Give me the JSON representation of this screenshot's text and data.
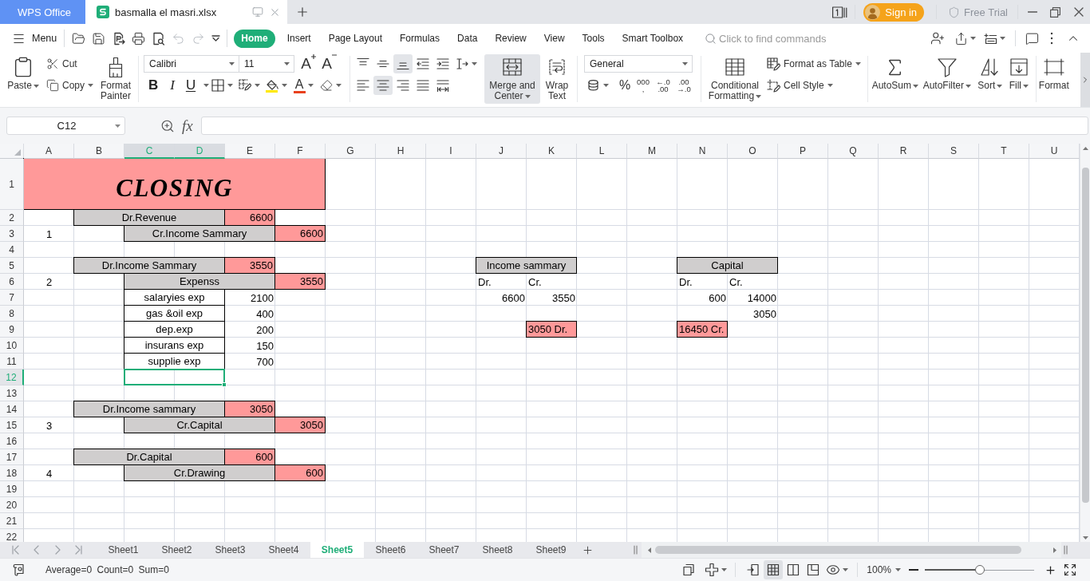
{
  "title_bar": {
    "app_tab": "WPS Office",
    "document_tab": "basmalla el masri.xlsx",
    "sign_in": "Sign in",
    "free_trial": "Free Trial"
  },
  "menu_bar": {
    "menu": "Menu",
    "quick_access": [
      {
        "kind": "open",
        "disabled": false
      },
      {
        "kind": "save",
        "disabled": false
      },
      {
        "kind": "export",
        "disabled": false
      },
      {
        "kind": "print",
        "disabled": false
      },
      {
        "kind": "preview",
        "disabled": false
      },
      {
        "kind": "undo",
        "disabled": true
      },
      {
        "kind": "redo",
        "disabled": true
      },
      {
        "kind": "customize",
        "disabled": false
      }
    ],
    "tabs": [
      {
        "label": "Home",
        "selected": true
      },
      {
        "label": "Insert",
        "selected": false
      },
      {
        "label": "Page Layout",
        "selected": false
      },
      {
        "label": "Formulas",
        "selected": false
      },
      {
        "label": "Data",
        "selected": false
      },
      {
        "label": "Review",
        "selected": false
      },
      {
        "label": "View",
        "selected": false
      },
      {
        "label": "Tools",
        "selected": false
      },
      {
        "label": "Smart Toolbox",
        "selected": false
      }
    ],
    "search": {
      "placeholder": "Click to find commands"
    }
  },
  "ribbon": {
    "paste": "Paste",
    "cut": "Cut",
    "copy": "Copy",
    "format_painter": [
      "Format",
      "Painter"
    ],
    "font_name": "Calibri",
    "font_size": "11",
    "size_buttons": [
      {
        "kind": "grow",
        "label": "A"
      },
      {
        "kind": "shrink",
        "label": "A"
      }
    ],
    "style_buttons": [
      {
        "kind": "bold",
        "label": "B"
      },
      {
        "kind": "italic",
        "label": "I"
      },
      {
        "kind": "underline",
        "label": "U"
      }
    ],
    "font_color": "A",
    "alignment_rows": [
      [
        {
          "kind": "top",
          "on": false
        },
        {
          "kind": "middle",
          "on": false
        },
        {
          "kind": "bottom",
          "on": true
        },
        {
          "kind": "outdent",
          "on": false
        },
        {
          "kind": "indent",
          "on": false
        },
        {
          "kind": "direction",
          "on": false
        }
      ],
      [
        {
          "kind": "left",
          "on": false
        },
        {
          "kind": "center",
          "on": true
        },
        {
          "kind": "right",
          "on": false
        },
        {
          "kind": "justify",
          "on": false
        },
        {
          "kind": "distributed",
          "on": false
        }
      ]
    ],
    "merge_center": {
      "lines": [
        "Merge and",
        "Center"
      ],
      "on": true
    },
    "wrap_text": [
      "Wrap",
      "Text"
    ],
    "number_format": "General",
    "number_buttons": [
      {
        "kind": "currency"
      },
      {
        "kind": "percent",
        "lines": [
          "%"
        ]
      },
      {
        "kind": "thousands",
        "lines": [
          "000",
          ","
        ]
      },
      {
        "kind": "increase_decimal",
        "lines": [
          "←.0",
          ".00"
        ]
      },
      {
        "kind": "decrease_decimal",
        "lines": [
          ".00",
          "→.0"
        ]
      }
    ],
    "conditional_formatting": [
      "Conditional",
      "Formatting"
    ],
    "format_as_table": "Format as Table",
    "cell_style": "Cell Style",
    "editing": [
      {
        "kind": "autosum",
        "label": "AutoSum"
      },
      {
        "kind": "autofilter",
        "label": "AutoFilter"
      },
      {
        "kind": "sort",
        "label": "Sort"
      },
      {
        "kind": "fill",
        "label": "Fill"
      },
      {
        "kind": "format",
        "label": "Format"
      }
    ]
  },
  "formula_bar": {
    "name_box": "C12",
    "function_label": "fx"
  },
  "sheet": {
    "columns": [
      {
        "label": "A",
        "selected": false
      },
      {
        "label": "B",
        "selected": false
      },
      {
        "label": "C",
        "selected": true
      },
      {
        "label": "D",
        "selected": true
      },
      {
        "label": "E",
        "selected": false
      },
      {
        "label": "F",
        "selected": false
      },
      {
        "label": "G",
        "selected": false
      },
      {
        "label": "H",
        "selected": false
      },
      {
        "label": "I",
        "selected": false
      },
      {
        "label": "J",
        "selected": false
      },
      {
        "label": "K",
        "selected": false
      },
      {
        "label": "L",
        "selected": false
      },
      {
        "label": "M",
        "selected": false
      },
      {
        "label": "N",
        "selected": false
      },
      {
        "label": "O",
        "selected": false
      },
      {
        "label": "P",
        "selected": false
      },
      {
        "label": "Q",
        "selected": false
      },
      {
        "label": "R",
        "selected": false
      },
      {
        "label": "S",
        "selected": false
      },
      {
        "label": "T",
        "selected": false
      },
      {
        "label": "U",
        "selected": false
      }
    ],
    "rows": [
      {
        "number": "1",
        "selected": false,
        "cells": [
          {
            "kind": "title",
            "text": "CLOSING",
            "color": "#ff9999",
            "bordered": true,
            "selected": false
          },
          {
            "kind": "merged"
          },
          {
            "kind": "merged"
          },
          {
            "kind": "merged"
          },
          {
            "kind": "merged"
          },
          {
            "kind": "merged"
          }
        ]
      },
      {
        "number": "2",
        "selected": false,
        "cells": [
          {
            "kind": "blank"
          },
          {
            "kind": "label",
            "text": "Dr.Revenue",
            "color": "#d0cece",
            "bordered": true,
            "selected": false
          },
          {
            "kind": "merged"
          },
          {
            "kind": "merged"
          },
          {
            "kind": "number",
            "text": "6600",
            "color": "#ff9999",
            "bordered": true,
            "selected": false
          }
        ]
      },
      {
        "number": "3",
        "selected": false,
        "cells": [
          {
            "kind": "label",
            "text": "1",
            "bordered": false,
            "selected": false
          },
          {
            "kind": "blank"
          },
          {
            "kind": "label",
            "text": "Cr.Income Sammary",
            "color": "#d0cece",
            "bordered": true,
            "selected": false
          },
          {
            "kind": "merged"
          },
          {
            "kind": "merged"
          },
          {
            "kind": "number",
            "text": "6600",
            "color": "#ff9999",
            "bordered": true,
            "selected": false
          }
        ]
      },
      {
        "number": "4",
        "selected": false
      },
      {
        "number": "5",
        "selected": false,
        "cells": [
          {
            "kind": "blank"
          },
          {
            "kind": "label",
            "text": "Dr.Income Sammary",
            "color": "#d0cece",
            "bordered": true,
            "selected": false
          },
          {
            "kind": "merged"
          },
          {
            "kind": "merged"
          },
          {
            "kind": "number",
            "text": "3550",
            "color": "#ff9999",
            "bordered": true,
            "selected": false
          },
          {
            "kind": "blank"
          },
          {
            "kind": "blank"
          },
          {
            "kind": "blank"
          },
          {
            "kind": "blank"
          },
          {
            "kind": "label",
            "text": "Income sammary",
            "color": "#d0cece",
            "bordered": true,
            "selected": false
          },
          {
            "kind": "merged"
          },
          {
            "kind": "blank"
          },
          {
            "kind": "blank"
          },
          {
            "kind": "label",
            "text": "Capital",
            "color": "#d0cece",
            "bordered": true,
            "selected": false
          },
          {
            "kind": "merged"
          }
        ]
      },
      {
        "number": "6",
        "selected": false,
        "cells": [
          {
            "kind": "label",
            "text": "2",
            "bordered": false,
            "selected": false
          },
          {
            "kind": "blank"
          },
          {
            "kind": "label",
            "text": "Expenss",
            "color": "#d0cece",
            "bordered": true,
            "selected": false
          },
          {
            "kind": "merged"
          },
          {
            "kind": "merged"
          },
          {
            "kind": "number",
            "text": "3550",
            "color": "#ff9999",
            "bordered": true,
            "selected": false
          },
          {
            "kind": "blank"
          },
          {
            "kind": "blank"
          },
          {
            "kind": "blank"
          },
          {
            "kind": "note",
            "text": "Dr.",
            "bordered": false,
            "selected": false
          },
          {
            "kind": "note",
            "text": "Cr.",
            "bordered": false,
            "selected": false
          },
          {
            "kind": "blank"
          },
          {
            "kind": "blank"
          },
          {
            "kind": "note",
            "text": "Dr.",
            "bordered": false,
            "selected": false
          },
          {
            "kind": "note",
            "text": "Cr.",
            "bordered": false,
            "selected": false
          }
        ]
      },
      {
        "number": "7",
        "selected": false,
        "cells": [
          {
            "kind": "blank"
          },
          {
            "kind": "blank"
          },
          {
            "kind": "label",
            "text": "salaryies exp",
            "bordered": true,
            "selected": false
          },
          {
            "kind": "merged"
          },
          {
            "kind": "number",
            "text": "2100",
            "bordered": false,
            "selected": false
          },
          {
            "kind": "blank"
          },
          {
            "kind": "blank"
          },
          {
            "kind": "blank"
          },
          {
            "kind": "blank"
          },
          {
            "kind": "number",
            "text": "6600",
            "bordered": false,
            "selected": false
          },
          {
            "kind": "number",
            "text": "3550",
            "bordered": false,
            "selected": false
          },
          {
            "kind": "blank"
          },
          {
            "kind": "blank"
          },
          {
            "kind": "number",
            "text": "600",
            "bordered": false,
            "selected": false
          },
          {
            "kind": "number",
            "text": "14000",
            "bordered": false,
            "selected": false
          }
        ]
      },
      {
        "number": "8",
        "selected": false,
        "cells": [
          {
            "kind": "blank"
          },
          {
            "kind": "blank"
          },
          {
            "kind": "label",
            "text": "gas &oil exp",
            "bordered": true,
            "selected": false
          },
          {
            "kind": "merged"
          },
          {
            "kind": "number",
            "text": "400",
            "bordered": false,
            "selected": false
          },
          {
            "kind": "blank"
          },
          {
            "kind": "blank"
          },
          {
            "kind": "blank"
          },
          {
            "kind": "blank"
          },
          {
            "kind": "blank"
          },
          {
            "kind": "blank"
          },
          {
            "kind": "blank"
          },
          {
            "kind": "blank"
          },
          {
            "kind": "blank"
          },
          {
            "kind": "number",
            "text": "3050",
            "bordered": false,
            "selected": false
          }
        ]
      },
      {
        "number": "9",
        "selected": false,
        "cells": [
          {
            "kind": "blank"
          },
          {
            "kind": "blank"
          },
          {
            "kind": "label",
            "text": "dep.exp",
            "bordered": true,
            "selected": false
          },
          {
            "kind": "merged"
          },
          {
            "kind": "number",
            "text": "200",
            "bordered": false,
            "selected": false
          },
          {
            "kind": "blank"
          },
          {
            "kind": "blank"
          },
          {
            "kind": "blank"
          },
          {
            "kind": "blank"
          },
          {
            "kind": "blank"
          },
          {
            "kind": "note",
            "text": "3050 Dr.",
            "color": "#ff9999",
            "bordered": true,
            "selected": false
          },
          {
            "kind": "blank"
          },
          {
            "kind": "blank"
          },
          {
            "kind": "note",
            "text": "16450 Cr.",
            "color": "#ff9999",
            "bordered": true,
            "selected": false
          }
        ]
      },
      {
        "number": "10",
        "selected": false,
        "cells": [
          {
            "kind": "blank"
          },
          {
            "kind": "blank"
          },
          {
            "kind": "label",
            "text": "insurans exp",
            "bordered": true,
            "selected": false
          },
          {
            "kind": "merged"
          },
          {
            "kind": "number",
            "text": "150",
            "bordered": false,
            "selected": false
          }
        ]
      },
      {
        "number": "11",
        "selected": false,
        "cells": [
          {
            "kind": "blank"
          },
          {
            "kind": "blank"
          },
          {
            "kind": "label",
            "text": "supplie exp",
            "bordered": true,
            "selected": false
          },
          {
            "kind": "merged"
          },
          {
            "kind": "number",
            "text": "700",
            "bordered": false,
            "selected": false
          }
        ]
      },
      {
        "number": "12",
        "selected": true,
        "cells": [
          {
            "kind": "blank"
          },
          {
            "kind": "blank"
          },
          {
            "kind": "blank",
            "selected": true
          },
          {
            "kind": "merged"
          }
        ]
      },
      {
        "number": "13",
        "selected": false
      },
      {
        "number": "14",
        "selected": false,
        "cells": [
          {
            "kind": "blank"
          },
          {
            "kind": "label",
            "text": "Dr.Income sammary",
            "color": "#d0cece",
            "bordered": true,
            "selected": false
          },
          {
            "kind": "merged"
          },
          {
            "kind": "merged"
          },
          {
            "kind": "number",
            "text": "3050",
            "color": "#ff9999",
            "bordered": true,
            "selected": false
          }
        ]
      },
      {
        "number": "15",
        "selected": false,
        "cells": [
          {
            "kind": "label",
            "text": "3",
            "bordered": false,
            "selected": false
          },
          {
            "kind": "blank"
          },
          {
            "kind": "label",
            "text": "Cr.Capital",
            "color": "#d0cece",
            "bordered": true,
            "selected": false
          },
          {
            "kind": "merged"
          },
          {
            "kind": "merged"
          },
          {
            "kind": "number",
            "text": "3050",
            "color": "#ff9999",
            "bordered": true,
            "selected": false
          }
        ]
      },
      {
        "number": "16",
        "selected": false
      },
      {
        "number": "17",
        "selected": false,
        "cells": [
          {
            "kind": "blank"
          },
          {
            "kind": "label",
            "text": "Dr.Capital",
            "color": "#d0cece",
            "bordered": true,
            "selected": false
          },
          {
            "kind": "merged"
          },
          {
            "kind": "merged"
          },
          {
            "kind": "number",
            "text": "600",
            "color": "#ff9999",
            "bordered": true,
            "selected": false
          }
        ]
      },
      {
        "number": "18",
        "selected": false,
        "cells": [
          {
            "kind": "label",
            "text": "4",
            "bordered": false,
            "selected": false
          },
          {
            "kind": "blank"
          },
          {
            "kind": "label",
            "text": "Cr.Drawing",
            "color": "#d0cece",
            "bordered": true,
            "selected": false
          },
          {
            "kind": "merged"
          },
          {
            "kind": "merged"
          },
          {
            "kind": "number",
            "text": "600",
            "color": "#ff9999",
            "bordered": true,
            "selected": false
          }
        ]
      },
      {
        "number": "19",
        "selected": false
      },
      {
        "number": "20",
        "selected": false
      },
      {
        "number": "21",
        "selected": false
      },
      {
        "number": "22",
        "selected": false
      }
    ]
  },
  "sheet_tabs": [
    {
      "label": "Sheet1",
      "selected": false
    },
    {
      "label": "Sheet2",
      "selected": false
    },
    {
      "label": "Sheet3",
      "selected": false
    },
    {
      "label": "Sheet4",
      "selected": false
    },
    {
      "label": "Sheet5",
      "selected": true
    },
    {
      "label": "Sheet6",
      "selected": false
    },
    {
      "label": "Sheet7",
      "selected": false
    },
    {
      "label": "Sheet8",
      "selected": false
    },
    {
      "label": "Sheet9",
      "selected": false
    }
  ],
  "status_bar": {
    "summary": "Average=0 Count=0 Sum=0",
    "view_modes": [
      {
        "kind": "reading",
        "selected": false
      },
      {
        "kind": "normal",
        "selected": true
      },
      {
        "kind": "page_break",
        "selected": false
      },
      {
        "kind": "page_layout",
        "selected": false
      }
    ],
    "zoom": "100%",
    "zoom_slider": {
      "level": 0.5
    }
  }
}
